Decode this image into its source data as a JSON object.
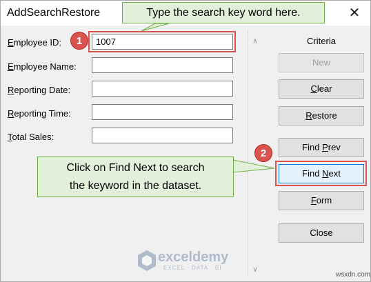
{
  "window": {
    "title": "AddSearchRestore",
    "close_glyph": "✕"
  },
  "form": {
    "fields": [
      {
        "label_prefix": "",
        "label_underline": "E",
        "label_rest": "mployee ID:",
        "value": "1007"
      },
      {
        "label_prefix": "",
        "label_underline": "E",
        "label_rest": "mployee Name:",
        "value": ""
      },
      {
        "label_prefix": "",
        "label_underline": "R",
        "label_rest": "eporting Date:",
        "value": ""
      },
      {
        "label_prefix": "",
        "label_underline": "R",
        "label_rest": "eporting Time:",
        "value": ""
      },
      {
        "label_prefix": "",
        "label_underline": "T",
        "label_rest": "otal Sales:",
        "value": ""
      }
    ]
  },
  "side_panel": {
    "criteria_label": "Criteria",
    "buttons": [
      {
        "pre": "",
        "ul": "",
        "post": "New",
        "enabled": false
      },
      {
        "pre": "",
        "ul": "C",
        "post": "lear",
        "enabled": true
      },
      {
        "pre": "",
        "ul": "R",
        "post": "estore",
        "enabled": true
      },
      {
        "pre": "Find ",
        "ul": "P",
        "post": "rev",
        "enabled": true
      },
      {
        "pre": "Find ",
        "ul": "N",
        "post": "ext",
        "enabled": true
      },
      {
        "pre": "",
        "ul": "F",
        "post": "orm",
        "enabled": true
      },
      {
        "pre": "",
        "ul": "",
        "post": "Close",
        "enabled": true
      }
    ],
    "scroll_up_glyph": "∧",
    "scroll_down_glyph": "∨"
  },
  "annotations": {
    "callout_top": "Type the search key word here.",
    "callout_bottom_line1": "Click on Find Next to search",
    "callout_bottom_line2": "the keyword in the dataset.",
    "badge_1": "1",
    "badge_2": "2",
    "highlight_color": "#d9534f",
    "callout_fill": "#e2efd9",
    "callout_border": "#70ad47"
  },
  "watermark": {
    "name": "exceldemy",
    "tagline": "EXCEL · DATA · BI",
    "icon": "exceldemy-logo-icon"
  },
  "site_credit": "wsxdn.com"
}
